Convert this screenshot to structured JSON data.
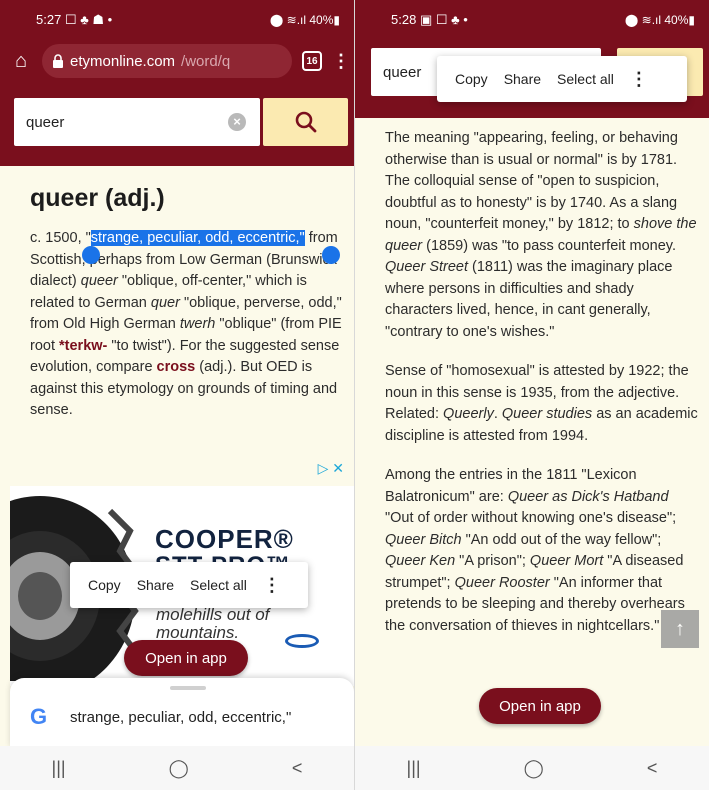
{
  "left": {
    "status": {
      "time": "5:27",
      "icons": "☐ ♣ ☗ •",
      "right": "⬤ ≋.ıl 40%▮"
    },
    "url": {
      "domain": "etymonline.com",
      "path": "/word/q",
      "tabs": "16"
    },
    "search": {
      "value": "queer"
    },
    "entry": {
      "title": "queer (adj.)",
      "p1_pre": "c. 1500, \"",
      "p1_sel": "strange, peculiar, odd, eccentric,\"",
      "p1_a": " from Scottish, perhaps from Low German (Brunswick dialect) ",
      "p1_b": "queer",
      "p1_c": " \"oblique, off-center,\" which is related to German ",
      "p1_d": "quer",
      "p1_e": " \"oblique, perverse, odd,\" from Old High German ",
      "p1_f": "twerh",
      "p1_g": " \"oblique\" (from PIE root ",
      "p1_h": "*terkw-",
      "p1_i": " \"to twist\"). For the suggested sense evolution, compare ",
      "p1_j": "cross",
      "p1_k": " (adj.). But OED is against this etymology on grounds of timing and sense."
    },
    "ad": {
      "adchoices": "▷ ✕",
      "brand": "COOPER®",
      "model": "STT PRO™",
      "tagline1": "molehills out of",
      "tagline2": "mountains."
    },
    "context_menu": {
      "copy": "Copy",
      "share": "Share",
      "select_all": "Select all",
      "more": "⋮"
    },
    "open_in_app": "Open in app",
    "google_sheet": {
      "g": "G",
      "query": "strange, peculiar, odd, eccentric,\""
    },
    "nav": {
      "recent": "|||",
      "home": "◯",
      "back": "<"
    }
  },
  "right": {
    "status": {
      "time": "5:28",
      "icons": "▣ ☐ ♣ •",
      "right": "⬤ ≋.ıl 40%▮"
    },
    "search": {
      "value": "queer"
    },
    "context_menu": {
      "copy": "Copy",
      "share": "Share",
      "select_all": "Select all",
      "more": "⋮"
    },
    "p1_a": "The meaning \"appearing, feeling, or behaving otherwise than is usual or normal\" is by 1781. The colloquial sense of \"open to suspicion, doubtful as to honesty\" is by 1740. As a slang noun, \"counterfeit money,\" by 1812; to ",
    "p1_b": "shove the queer",
    "p1_c": " (1859) was \"to pass counterfeit money. ",
    "p1_d": "Queer Street",
    "p1_e": " (1811) was the imaginary place where persons in difficulties and shady characters lived, hence, in cant generally, \"contrary to one's wishes.\"",
    "p2_a": "Sense of \"homosexual\" is attested by 1922; the noun in this sense is 1935, from the adjective. Related: ",
    "p2_b": "Queerly",
    "p2_c": ". ",
    "p2_d": "Queer studies",
    "p2_e": " as an academic discipline is attested from 1994.",
    "p3_a": "Among the entries in the 1811 \"Lexicon Balatronicum\" are: ",
    "p3_b": "Queer as Dick's Hatband",
    "p3_c": " \"Out of order without knowing one's disease\"; ",
    "p3_d": "Queer Bitch",
    "p3_e": " \"An odd out of the way fellow\"; ",
    "p3_f": "Queer Ken",
    "p3_g": " \"A prison\"; ",
    "p3_h": "Queer Mort",
    "p3_i": " \"A diseased strumpet\"; ",
    "p3_j": "Queer Rooster",
    "p3_k": " \"An informer that pretends to be sleeping and thereby overhears the conversation of thieves in nightcellars.\"",
    "open_in_app": "Open in app",
    "scroll_top": "↑",
    "nav": {
      "recent": "|||",
      "home": "◯",
      "back": "<"
    }
  }
}
